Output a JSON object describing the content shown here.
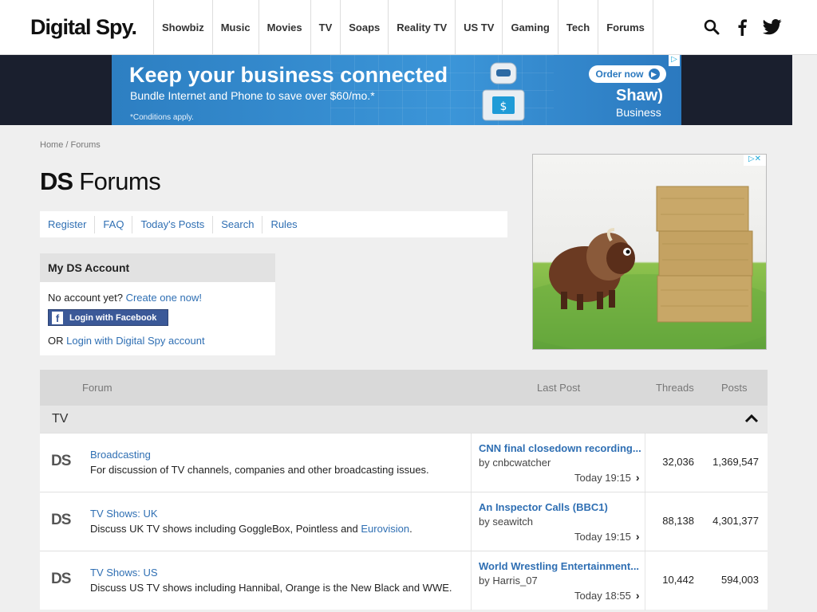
{
  "header": {
    "logo": "Digital Spy.",
    "nav": [
      "Showbiz",
      "Music",
      "Movies",
      "TV",
      "Soaps",
      "Reality TV",
      "US TV",
      "Gaming",
      "Tech",
      "Forums"
    ],
    "icons": [
      "search-icon",
      "facebook-icon",
      "twitter-icon"
    ]
  },
  "banner_ad": {
    "title": "Keep your business connected",
    "subtitle": "Bundle Internet and Phone to save over $60/mo.*",
    "conditions": "*Conditions apply.",
    "order_label": "Order now",
    "brand": "Shaw)",
    "brand_sub": "Business"
  },
  "breadcrumb": {
    "home": "Home",
    "separator": " / ",
    "current": "Forums"
  },
  "page_title": {
    "prefix": "DS",
    "rest": " Forums"
  },
  "toolbar": {
    "links": [
      "Register",
      "FAQ",
      "Today's Posts",
      "Search",
      "Rules"
    ]
  },
  "account": {
    "title": "My DS Account",
    "no_account_text": "No account yet? ",
    "create_link": "Create one now!",
    "facebook_label": "Login with Facebook",
    "or_text": "OR ",
    "ds_login_link": "Login with Digital Spy account"
  },
  "forum_table": {
    "headers": {
      "forum": "Forum",
      "last_post": "Last Post",
      "threads": "Threads",
      "posts": "Posts"
    },
    "section": "TV",
    "rows": [
      {
        "icon": "DS",
        "name": "Broadcasting",
        "description": "For discussion of TV channels, companies and other broadcasting issues.",
        "last_post_title": "CNN final closedown recording...",
        "last_post_by": "by cnbcwatcher",
        "last_post_time": "Today 19:15",
        "threads": "32,036",
        "posts": "1,369,547"
      },
      {
        "icon": "DS",
        "name": "TV Shows: UK",
        "description": "Discuss UK TV shows including GoggleBox, Pointless and ",
        "description_link": "Eurovision",
        "description_end": ".",
        "last_post_title": "An Inspector Calls (BBC1)",
        "last_post_by": "by seawitch",
        "last_post_time": "Today 19:15",
        "threads": "88,138",
        "posts": "4,301,377"
      },
      {
        "icon": "DS",
        "name": "TV Shows: US",
        "description": "Discuss US TV shows including Hannibal, Orange is the New Black and WWE.",
        "last_post_title": "World Wrestling Entertainment...",
        "last_post_by": "by Harris_07",
        "last_post_time": "Today 18:55",
        "threads": "10,442",
        "posts": "594,003"
      }
    ]
  }
}
